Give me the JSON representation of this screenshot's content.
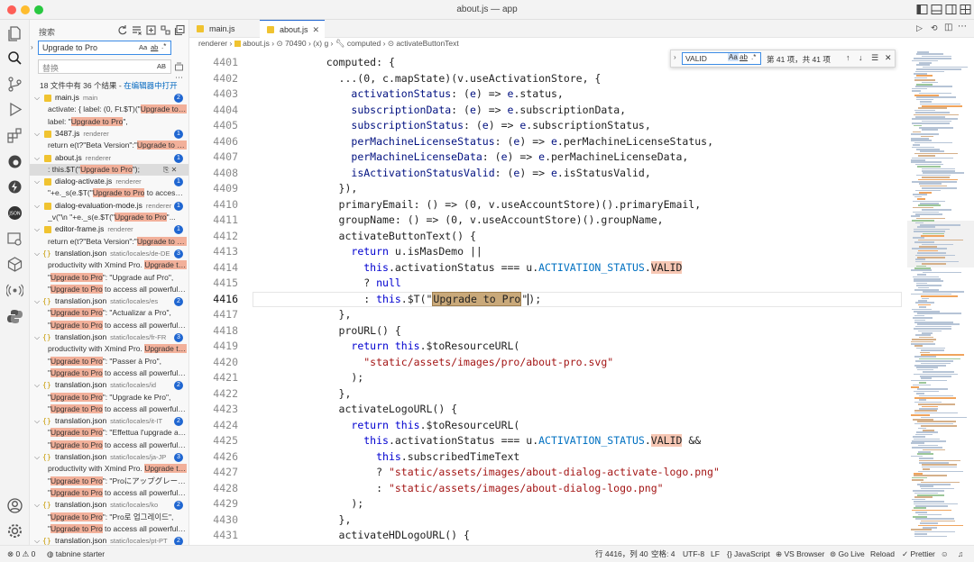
{
  "window": {
    "title": "about.js — app"
  },
  "sidebar": {
    "title": "搜索",
    "search_value": "Upgrade to Pro",
    "search_opts": [
      "Aa",
      "ab",
      ".*"
    ],
    "replace_placeholder": "替换",
    "replace_opt": "AB",
    "summary_text": "18 文件中有 36 个结果 - ",
    "summary_link": "在编辑器中打开"
  },
  "results": [
    {
      "kind": "file",
      "icon": "js",
      "name": "main.js",
      "path": "main",
      "count": "2"
    },
    {
      "kind": "match",
      "pre": "activate: { label: (0, Ft.$T)(\"",
      "hit": "Upgrade to P...",
      "post": ""
    },
    {
      "kind": "match",
      "pre": "label: \"",
      "hit": "Upgrade to Pro",
      "post": "\","
    },
    {
      "kind": "file",
      "icon": "js",
      "name": "3487.js",
      "path": "renderer",
      "count": "1"
    },
    {
      "kind": "match",
      "pre": "return e(t?\"Beta Version\":\"",
      "hit": "Upgrade to Pr...",
      "post": ""
    },
    {
      "kind": "file",
      "icon": "js",
      "name": "about.js",
      "path": "renderer",
      "count": "1"
    },
    {
      "kind": "match",
      "pre": ": this.$T(\"",
      "hit": "Upgrade to Pro",
      "post": "\");",
      "selected": true
    },
    {
      "kind": "file",
      "icon": "js",
      "name": "dialog-activate.js",
      "path": "renderer",
      "count": "1"
    },
    {
      "kind": "match",
      "pre": "\"+e._s(e.$T(\"",
      "hit": "Upgrade to Pro",
      "post": " to access al..."
    },
    {
      "kind": "file",
      "icon": "js",
      "name": "dialog-evaluation-mode.js",
      "path": "renderer",
      "count": "1"
    },
    {
      "kind": "match",
      "pre": "_v(\"\\n      \"+e._s(e.$T(\"",
      "hit": "Upgrade to Pro",
      "post": "\"..."
    },
    {
      "kind": "file",
      "icon": "js",
      "name": "editor-frame.js",
      "path": "renderer",
      "count": "1"
    },
    {
      "kind": "match",
      "pre": "return e(t?\"Beta Version\":\"",
      "hit": "Upgrade to Pr...",
      "post": ""
    },
    {
      "kind": "file",
      "icon": "json",
      "name": "translation.json",
      "path": "static/locales/de-DE",
      "count": "3"
    },
    {
      "kind": "match",
      "pre": "productivity with Xmind Pro. ",
      "hit": "Upgrade to ...",
      "post": ""
    },
    {
      "kind": "match",
      "pre": "\"",
      "hit": "Upgrade to Pro",
      "post": "\": \"Upgrade auf Pro\","
    },
    {
      "kind": "match",
      "pre": "\"",
      "hit": "Upgrade to Pro",
      "post": " to access all powerful fe..."
    },
    {
      "kind": "file",
      "icon": "json",
      "name": "translation.json",
      "path": "static/locales/es",
      "count": "2"
    },
    {
      "kind": "match",
      "pre": "\"",
      "hit": "Upgrade to Pro",
      "post": "\": \"Actualizar a Pro\","
    },
    {
      "kind": "match",
      "pre": "\"",
      "hit": "Upgrade to Pro",
      "post": " to access all powerful fe..."
    },
    {
      "kind": "file",
      "icon": "json",
      "name": "translation.json",
      "path": "static/locales/fr-FR",
      "count": "3"
    },
    {
      "kind": "match",
      "pre": "productivity with Xmind Pro. ",
      "hit": "Upgrade to ...",
      "post": ""
    },
    {
      "kind": "match",
      "pre": "\"",
      "hit": "Upgrade to Pro",
      "post": "\": \"Passer à Pro\","
    },
    {
      "kind": "match",
      "pre": "\"",
      "hit": "Upgrade to Pro",
      "post": " to access all powerful fe..."
    },
    {
      "kind": "file",
      "icon": "json",
      "name": "translation.json",
      "path": "static/locales/id",
      "count": "2"
    },
    {
      "kind": "match",
      "pre": "\"",
      "hit": "Upgrade to Pro",
      "post": "\": \"Upgrade ke Pro\","
    },
    {
      "kind": "match",
      "pre": "\"",
      "hit": "Upgrade to Pro",
      "post": " to access all powerful fe..."
    },
    {
      "kind": "file",
      "icon": "json",
      "name": "translation.json",
      "path": "static/locales/it-IT",
      "count": "2"
    },
    {
      "kind": "match",
      "pre": "\"",
      "hit": "Upgrade to Pro",
      "post": "\": \"Effettua l'upgrade a P..."
    },
    {
      "kind": "match",
      "pre": "\"",
      "hit": "Upgrade to Pro",
      "post": " to access all powerful fe..."
    },
    {
      "kind": "file",
      "icon": "json",
      "name": "translation.json",
      "path": "static/locales/ja-JP",
      "count": "3"
    },
    {
      "kind": "match",
      "pre": "productivity with Xmind Pro. ",
      "hit": "Upgrade to ...",
      "post": ""
    },
    {
      "kind": "match",
      "pre": "\"",
      "hit": "Upgrade to Pro",
      "post": "\": \"Proにアップグレード\","
    },
    {
      "kind": "match",
      "pre": "\"",
      "hit": "Upgrade to Pro",
      "post": " to access all powerful fe..."
    },
    {
      "kind": "file",
      "icon": "json",
      "name": "translation.json",
      "path": "static/locales/ko",
      "count": "2"
    },
    {
      "kind": "match",
      "pre": "\"",
      "hit": "Upgrade to Pro",
      "post": "\": \"Pro로 업그레이드\","
    },
    {
      "kind": "match",
      "pre": "\"",
      "hit": "Upgrade to Pro",
      "post": " to access all powerful fe..."
    },
    {
      "kind": "file",
      "icon": "json",
      "name": "translation.json",
      "path": "static/locales/pt-PT",
      "count": "2"
    }
  ],
  "tabs": [
    {
      "label": "main.js",
      "active": false
    },
    {
      "label": "about.js",
      "active": true,
      "close": "✕"
    }
  ],
  "breadcrumb": [
    "renderer",
    "about.js",
    "70490",
    "g",
    "computed",
    "activateButtonText"
  ],
  "find_widget": {
    "value": "VALID",
    "opts": [
      "Aa",
      "ab",
      ".*"
    ],
    "count": "第 41 项，共 41 项",
    "nav": [
      "↑",
      "↓",
      "☰",
      "✕"
    ]
  },
  "code": {
    "first_line": 4401,
    "current_line": 4416,
    "lines": [
      [
        [
          "    ",
          ""
        ],
        [
          "computed",
          ""
        ],
        [
          ": {",
          ""
        ]
      ],
      [
        [
          "      ...(",
          ""
        ],
        [
          "0",
          ""
        ],
        [
          ", c.mapState)(v.useActivationStore, {",
          ""
        ]
      ],
      [
        [
          "        ",
          ""
        ],
        [
          "activationStatus",
          "p"
        ],
        [
          ": (",
          ""
        ],
        [
          "e",
          "p"
        ],
        [
          ") => ",
          ""
        ],
        [
          "e",
          "p"
        ],
        [
          ".status,",
          ""
        ]
      ],
      [
        [
          "        ",
          ""
        ],
        [
          "subscriptionData",
          "p"
        ],
        [
          ": (",
          ""
        ],
        [
          "e",
          "p"
        ],
        [
          ") => ",
          ""
        ],
        [
          "e",
          "p"
        ],
        [
          ".subscriptionData,",
          ""
        ]
      ],
      [
        [
          "        ",
          ""
        ],
        [
          "subscriptionStatus",
          "p"
        ],
        [
          ": (",
          ""
        ],
        [
          "e",
          "p"
        ],
        [
          ") => ",
          ""
        ],
        [
          "e",
          "p"
        ],
        [
          ".subscriptionStatus,",
          ""
        ]
      ],
      [
        [
          "        ",
          ""
        ],
        [
          "perMachineLicenseStatus",
          "p"
        ],
        [
          ": (",
          ""
        ],
        [
          "e",
          "p"
        ],
        [
          ") => ",
          ""
        ],
        [
          "e",
          "p"
        ],
        [
          ".perMachineLicenseStatus,",
          ""
        ]
      ],
      [
        [
          "        ",
          ""
        ],
        [
          "perMachineLicenseData",
          "p"
        ],
        [
          ": (",
          ""
        ],
        [
          "e",
          "p"
        ],
        [
          ") => ",
          ""
        ],
        [
          "e",
          "p"
        ],
        [
          ".perMachineLicenseData,",
          ""
        ]
      ],
      [
        [
          "        ",
          ""
        ],
        [
          "isActivationStatusValid",
          "p"
        ],
        [
          ": (",
          ""
        ],
        [
          "e",
          "p"
        ],
        [
          ") => ",
          ""
        ],
        [
          "e",
          "p"
        ],
        [
          ".isStatusValid,",
          ""
        ]
      ],
      [
        [
          "      }),",
          ""
        ]
      ],
      [
        [
          "      ",
          ""
        ],
        [
          "primaryEmail",
          ""
        ],
        [
          ": () => (",
          ""
        ],
        [
          "0",
          ""
        ],
        [
          ", v.useAccountStore)().primaryEmail,",
          ""
        ]
      ],
      [
        [
          "      ",
          ""
        ],
        [
          "groupName",
          ""
        ],
        [
          ": () => (",
          ""
        ],
        [
          "0",
          ""
        ],
        [
          ", v.useAccountStore)().groupName,",
          ""
        ]
      ],
      [
        [
          "      ",
          ""
        ],
        [
          "activateButtonText",
          ""
        ],
        [
          "() {",
          ""
        ]
      ],
      [
        [
          "        ",
          ""
        ],
        [
          "return",
          "k"
        ],
        [
          " u.isMasDemo ||",
          ""
        ]
      ],
      [
        [
          "          ",
          ""
        ],
        [
          "this",
          "k"
        ],
        [
          ".activationStatus === u.",
          ""
        ],
        [
          "ACTIVATION_STATUS",
          "c"
        ],
        [
          ".",
          ""
        ],
        [
          "VALID",
          "fm"
        ]
      ],
      [
        [
          "          ? ",
          ""
        ],
        [
          "null",
          "k"
        ]
      ],
      [
        [
          "          : ",
          ""
        ],
        [
          "this",
          "k"
        ],
        [
          ".$T(\"",
          ""
        ],
        [
          "Upgrade to Pro",
          "fcur"
        ],
        [
          "\"",
          ""
        ],
        [
          "|",
          "caret"
        ],
        [
          ");",
          ""
        ]
      ],
      [
        [
          "      },",
          ""
        ]
      ],
      [
        [
          "      ",
          ""
        ],
        [
          "proURL",
          ""
        ],
        [
          "() {",
          ""
        ]
      ],
      [
        [
          "        ",
          ""
        ],
        [
          "return",
          "k"
        ],
        [
          " ",
          ""
        ],
        [
          "this",
          "k"
        ],
        [
          ".$toResourceURL(",
          ""
        ]
      ],
      [
        [
          "          ",
          ""
        ],
        [
          "\"static/assets/images/pro/about-pro.svg\"",
          "s"
        ]
      ],
      [
        [
          "        );",
          ""
        ]
      ],
      [
        [
          "      },",
          ""
        ]
      ],
      [
        [
          "      ",
          ""
        ],
        [
          "activateLogoURL",
          ""
        ],
        [
          "() {",
          ""
        ]
      ],
      [
        [
          "        ",
          ""
        ],
        [
          "return",
          "k"
        ],
        [
          " ",
          ""
        ],
        [
          "this",
          "k"
        ],
        [
          ".$toResourceURL(",
          ""
        ]
      ],
      [
        [
          "          ",
          ""
        ],
        [
          "this",
          "k"
        ],
        [
          ".activationStatus === u.",
          ""
        ],
        [
          "ACTIVATION_STATUS",
          "c"
        ],
        [
          ".",
          ""
        ],
        [
          "VALID",
          "fm"
        ],
        [
          " &&",
          ""
        ]
      ],
      [
        [
          "            ",
          ""
        ],
        [
          "this",
          "k"
        ],
        [
          ".subscribedTimeText",
          ""
        ]
      ],
      [
        [
          "            ? ",
          ""
        ],
        [
          "\"static/assets/images/about-dialog-activate-logo.png\"",
          "s"
        ]
      ],
      [
        [
          "            : ",
          ""
        ],
        [
          "\"static/assets/images/about-dialog-logo.png\"",
          "s"
        ]
      ],
      [
        [
          "        );",
          ""
        ]
      ],
      [
        [
          "      },",
          ""
        ]
      ],
      [
        [
          "      ",
          ""
        ],
        [
          "activateHDLogoURL",
          ""
        ],
        [
          "() {",
          ""
        ]
      ]
    ]
  },
  "status": {
    "errors": "0",
    "warnings": "0",
    "tabnine": "tabnine starter",
    "pos": "行 4416，列 40",
    "spaces": "空格: 4",
    "enc": "UTF-8",
    "eol": "LF",
    "lang": "{} JavaScript",
    "browser": "VS Browser",
    "golive": "Go Live",
    "reload": "Reload",
    "prettier": "✓ Prettier"
  },
  "colors": {
    "accent": "#1f66d1",
    "match": "#f2b09a",
    "current_match": "#c9a97a"
  }
}
